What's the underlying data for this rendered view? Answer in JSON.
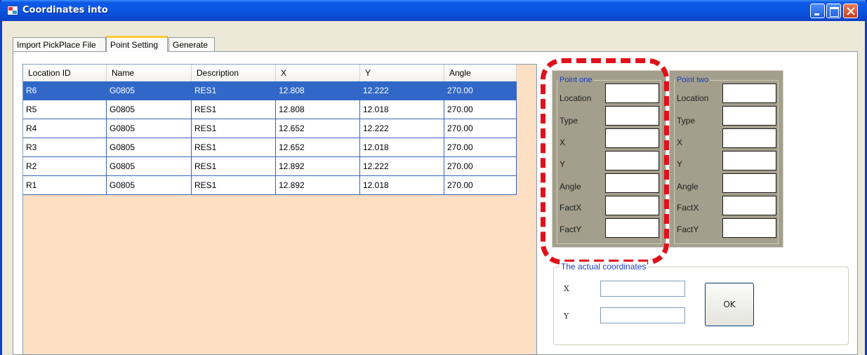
{
  "window": {
    "title": "Coordinates into"
  },
  "tabs": [
    {
      "label": "Import PickPlace File"
    },
    {
      "label": "Point Setting",
      "selected": true
    },
    {
      "label": "Generate"
    }
  ],
  "grid": {
    "columns": [
      "Location ID",
      "Name",
      "Description",
      "X",
      "Y",
      "Angle"
    ],
    "rows": [
      {
        "location_id": "R6",
        "name": "G0805",
        "description": "RES1",
        "x": "12.808",
        "y": "12.222",
        "angle": "270.00",
        "selected": true
      },
      {
        "location_id": "R5",
        "name": "G0805",
        "description": "RES1",
        "x": "12.808",
        "y": "12.018",
        "angle": "270.00"
      },
      {
        "location_id": "R4",
        "name": "G0805",
        "description": "RES1",
        "x": "12.652",
        "y": "12.222",
        "angle": "270.00"
      },
      {
        "location_id": "R3",
        "name": "G0805",
        "description": "RES1",
        "x": "12.652",
        "y": "12.018",
        "angle": "270.00"
      },
      {
        "location_id": "R2",
        "name": "G0805",
        "description": "RES1",
        "x": "12.892",
        "y": "12.222",
        "angle": "270.00"
      },
      {
        "location_id": "R1",
        "name": "G0805",
        "description": "RES1",
        "x": "12.892",
        "y": "12.018",
        "angle": "270.00"
      }
    ]
  },
  "point_one": {
    "legend": "Point one",
    "fields": [
      "Location",
      "Type",
      "X",
      "Y",
      "Angle",
      "FactX",
      "FactY"
    ],
    "values": [
      "",
      "",
      "",
      "",
      "",
      "",
      ""
    ]
  },
  "point_two": {
    "legend": "Point two",
    "fields": [
      "Location",
      "Type",
      "X",
      "Y",
      "Angle",
      "FactX",
      "FactY"
    ],
    "values": [
      "",
      "",
      "",
      "",
      "",
      "",
      ""
    ]
  },
  "actual_coordinates": {
    "legend": "The actual coordinates",
    "x_label": "X",
    "y_label": "Y",
    "x_value": "",
    "y_value": "",
    "ok_label": "OK"
  },
  "colors": {
    "title_bar": "#0a55e0",
    "grid_background": "#fddfc3",
    "selected_row": "#3168c8",
    "group_background": "#a39f8c",
    "highlight": "#e0111b"
  }
}
